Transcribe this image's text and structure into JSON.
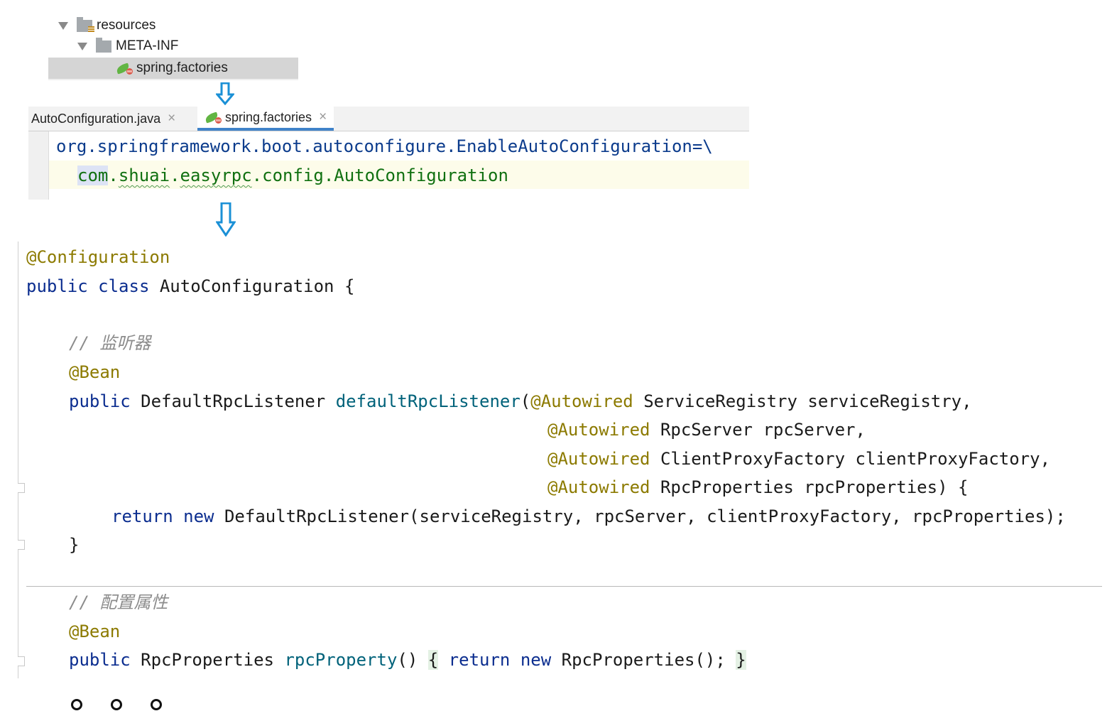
{
  "project_tree": {
    "resources_label": "resources",
    "meta_inf_label": "META-INF",
    "spring_factories_label": "spring.factories"
  },
  "editor_tabs": [
    {
      "label": "AutoConfiguration.java",
      "close": "×"
    },
    {
      "label": "spring.factories",
      "close": "×"
    }
  ],
  "factories_file": {
    "line1_key": "org.springframework.boot.autoconfigure.EnableAutoConfiguration",
    "line1_op": "=\\",
    "line2_pkg_com": "com",
    "line2_pkg_dot1": ".",
    "line2_pkg_shuai": "shuai",
    "line2_pkg_dot2": ".",
    "line2_pkg_easyrpc": "easyrpc",
    "line2_rest": ".config.AutoConfiguration"
  },
  "java_code": {
    "anno_configuration": "@Configuration",
    "kw_public": "public",
    "kw_class": "class",
    "kw_return": "return",
    "kw_new": "new",
    "class_name": "AutoConfiguration",
    "open_brace": " {",
    "comment_listener": "// 监听器",
    "anno_bean": "@Bean",
    "listener_type": "DefaultRpcListener",
    "listener_method": "defaultRpcListener",
    "open_paren": "(",
    "anno_autowired": "@Autowired",
    "param1": " ServiceRegistry serviceRegistry,",
    "param2": " RpcServer rpcServer,",
    "param3": " ClientProxyFactory clientProxyFactory,",
    "param4": " RpcProperties rpcProperties) {",
    "return_stmt": " DefaultRpcListener(serviceRegistry, rpcServer, clientProxyFactory, rpcProperties);",
    "close_brace": "}",
    "comment_props": "// 配置属性",
    "props_type": "RpcProperties",
    "props_method": "rpcProperty",
    "props_parens": "()",
    "props_open": "{",
    "props_body": " RpcProperties();",
    "props_close": "}"
  }
}
